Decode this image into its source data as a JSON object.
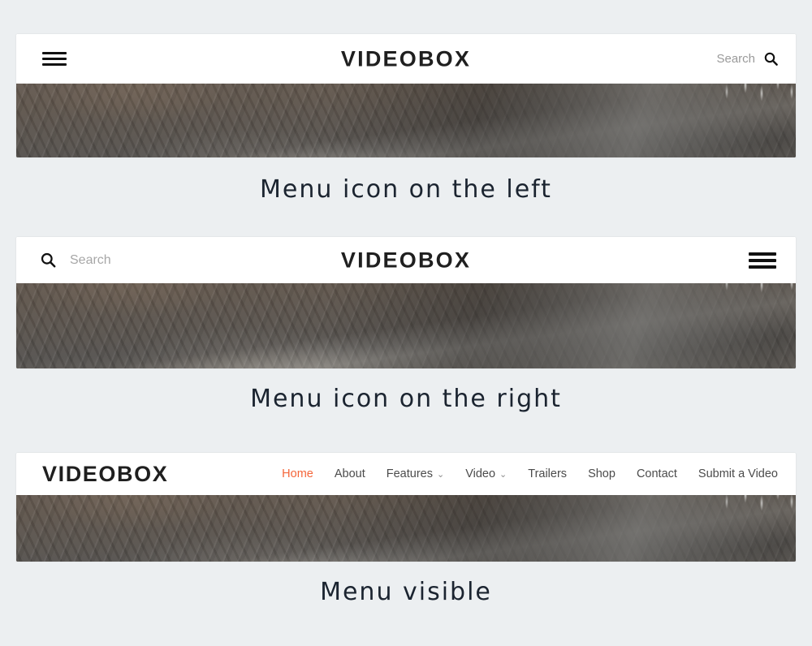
{
  "page": {
    "background_color": "#eceff1",
    "brand_name": "VIDEOBOX",
    "accent_color": "#f4663a",
    "text_color": "#4b4b4b",
    "caption_color": "#1b2430"
  },
  "variants": [
    {
      "id": "menu-left",
      "caption": "Menu icon on the left",
      "logo": "VIDEOBOX",
      "logo_position": "center",
      "menu_icon": "hamburger-icon",
      "menu_icon_position": "left",
      "search": {
        "label": "Search",
        "icon": "search-icon",
        "position": "right",
        "style": "label-with-icon"
      }
    },
    {
      "id": "menu-right",
      "caption": "Menu icon on the right",
      "logo": "VIDEOBOX",
      "logo_position": "center",
      "menu_icon": "hamburger-icon",
      "menu_icon_position": "right",
      "search": {
        "placeholder": "Search",
        "icon": "search-icon",
        "position": "left",
        "style": "icon-with-input"
      }
    },
    {
      "id": "menu-visible",
      "caption": "Menu visible",
      "logo": "VIDEOBOX",
      "logo_position": "left",
      "nav_items": [
        {
          "label": "Home",
          "active": true,
          "has_dropdown": false
        },
        {
          "label": "About",
          "active": false,
          "has_dropdown": false
        },
        {
          "label": "Features",
          "active": false,
          "has_dropdown": true
        },
        {
          "label": "Video",
          "active": false,
          "has_dropdown": true
        },
        {
          "label": "Trailers",
          "active": false,
          "has_dropdown": false
        },
        {
          "label": "Shop",
          "active": false,
          "has_dropdown": false
        },
        {
          "label": "Contact",
          "active": false,
          "has_dropdown": false
        },
        {
          "label": "Submit a Video",
          "active": false,
          "has_dropdown": false
        }
      ]
    }
  ],
  "icons": {
    "chevron_down": "⌄"
  }
}
